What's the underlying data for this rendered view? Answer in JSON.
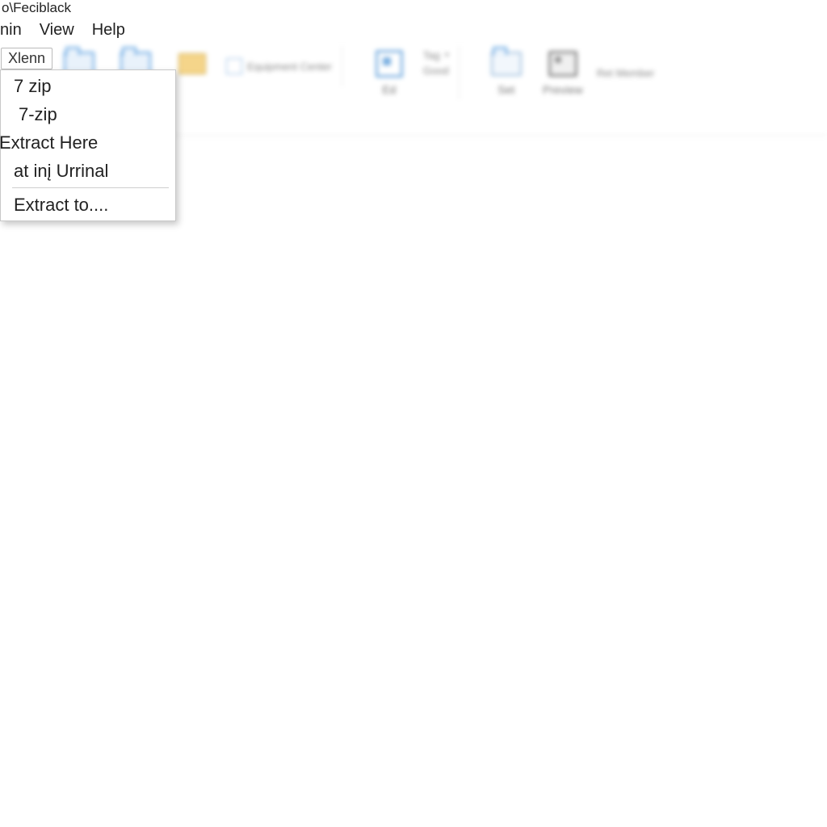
{
  "title": "o\\Feciblack",
  "menu": {
    "items": [
      "nin",
      "View",
      "Help"
    ]
  },
  "ribbon": {
    "tab_label": "Xlenn",
    "buttons": [
      {
        "label": ""
      },
      {
        "label": ""
      },
      {
        "label": ""
      },
      {
        "label": "Equipment Center"
      }
    ],
    "group2": {
      "big_label": "Ed",
      "small1": "Tag",
      "small2": "Good"
    },
    "group3": {
      "btn1": "Set",
      "btn2": "Preview",
      "btn3": "Ret Member"
    }
  },
  "context_menu": {
    "items": [
      {
        "label": "7 zip",
        "kind": "item"
      },
      {
        "label": "7-zip",
        "kind": "item_indent"
      },
      {
        "label": "Extract Here",
        "kind": "item_neg"
      },
      {
        "label": "at inį Urrinal",
        "kind": "item"
      },
      {
        "kind": "sep"
      },
      {
        "label": "Extract to....",
        "kind": "item"
      }
    ]
  }
}
